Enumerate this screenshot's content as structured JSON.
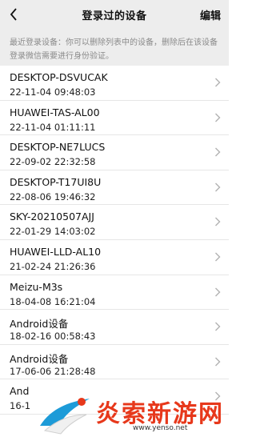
{
  "header": {
    "title": "登录过的设备",
    "edit_label": "编辑"
  },
  "notice": "最近登录设备：你可以删除列表中的设备，删除后在该设备登录微信需要进行身份验证。",
  "devices": [
    {
      "name": "DESKTOP-DSVUCAK",
      "time": "22-11-04 09:48:03"
    },
    {
      "name": "HUAWEI-TAS-AL00",
      "time": "22-11-04 01:11:11"
    },
    {
      "name": "DESKTOP-NE7LUCS",
      "time": "22-09-02 22:32:58"
    },
    {
      "name": "DESKTOP-T17UI8U",
      "time": "22-08-06 19:46:32"
    },
    {
      "name": "SKY-20210507AJJ",
      "time": "22-01-29 14:03:02"
    },
    {
      "name": "HUAWEI-LLD-AL10",
      "time": "21-02-24 21:26:36"
    },
    {
      "name": "Meizu-M3s",
      "time": "18-04-08 16:21:04"
    },
    {
      "name": "Android设备",
      "time": "18-02-16 00:58:43"
    },
    {
      "name": "Android设备",
      "time": "17-06-06 21:28:48"
    },
    {
      "name": "And",
      "time": "16-1"
    }
  ],
  "watermark": {
    "text": "炎索新游网",
    "url": "www.yenso.net"
  }
}
